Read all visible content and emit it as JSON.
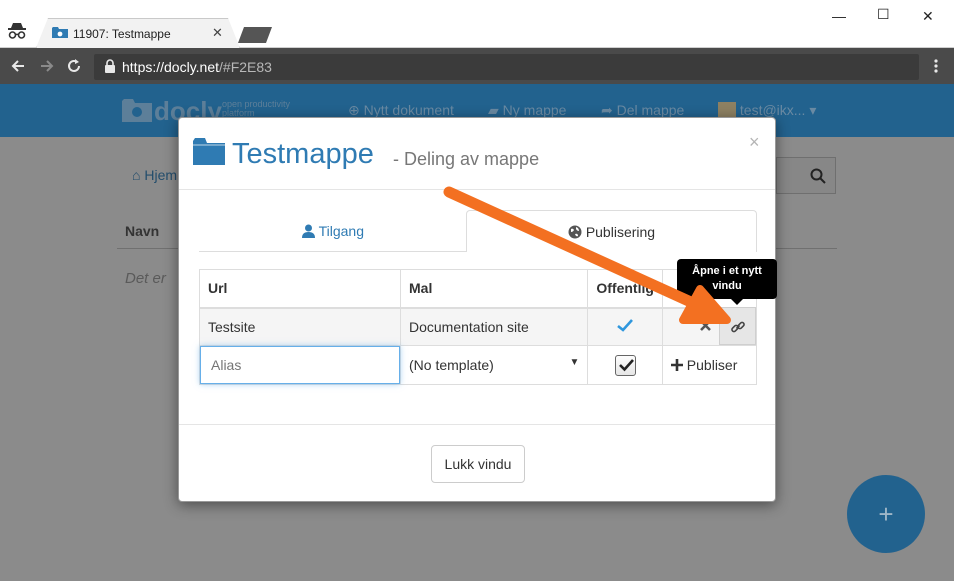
{
  "browser": {
    "tab_title": "11907: Testmappe",
    "tab_close": "✕",
    "url_host": "https://docly.net",
    "url_path": "/#F2E83",
    "window_minimize": "—",
    "window_maximize": "☐",
    "window_close": "✕"
  },
  "app": {
    "logo_text": "docly",
    "logo_sub_1": "open productivity",
    "logo_sub_2": "platform",
    "nav": {
      "new_document": "Nytt dokument",
      "new_folder": "Ny mappe",
      "share_folder": "Del mappe",
      "user": "test@ikx..."
    },
    "breadcrumb_home": "Hjem",
    "column_name": "Navn",
    "empty_text": "Det er",
    "fab_label": "+"
  },
  "modal": {
    "title": "Testmappe",
    "subtitle": "- Deling av mappe",
    "close_symbol": "×",
    "tabs": {
      "access": "Tilgang",
      "publishing": "Publisering"
    },
    "table": {
      "headers": [
        "Url",
        "Mal",
        "Offentlig",
        ""
      ],
      "rows": [
        {
          "url": "Testsite",
          "template": "Documentation site",
          "public": true
        }
      ],
      "new_row": {
        "alias_placeholder": "Alias",
        "template_selected": "(No template)",
        "public_checked": true,
        "publish_label": "Publiser"
      }
    },
    "tooltip": {
      "line1": "Åpne i et nytt",
      "line2": "vindu"
    },
    "close_button": "Lukk vindu"
  },
  "colors": {
    "header_blue": "#22628e",
    "title_blue": "#2f7bb3",
    "annotation_arrow": "#f37021"
  }
}
